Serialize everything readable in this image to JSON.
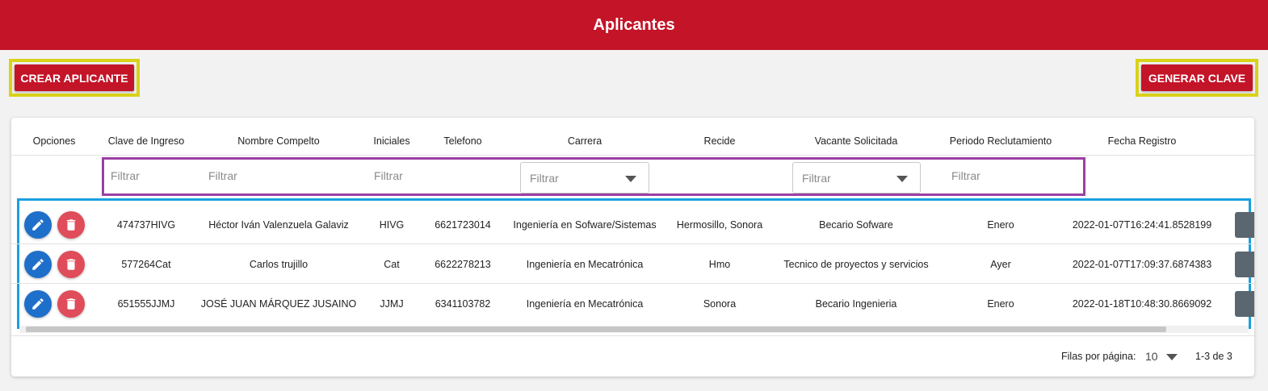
{
  "header": {
    "title": "Aplicantes"
  },
  "toolbar": {
    "create_label": "CREAR APLICANTE",
    "generate_label": "GENERAR CLAVE"
  },
  "table": {
    "columns": [
      "Opciones",
      "Clave de Ingreso",
      "Nombre Compelto",
      "Iniciales",
      "Telefono",
      "Carrera",
      "Recide",
      "Vacante Solicitada",
      "Periodo Reclutamiento",
      "Fecha Registro"
    ],
    "filter_placeholder": "Filtrar",
    "rows": [
      {
        "clave": "474737HIVG",
        "nombre": "Héctor Iván Valenzuela Galaviz",
        "iniciales": "HIVG",
        "telefono": "6621723014",
        "carrera": "Ingeniería en Sofware/Sistemas",
        "recide": "Hermosillo, Sonora",
        "vacante": "Becario Sofware",
        "periodo": "Enero",
        "fecha": "2022-01-07T16:24:41.8528199"
      },
      {
        "clave": "577264Cat",
        "nombre": "Carlos trujillo",
        "iniciales": "Cat",
        "telefono": "6622278213",
        "carrera": "Ingeniería en Mecatrónica",
        "recide": "Hmo",
        "vacante": "Tecnico de proyectos y servicios",
        "periodo": "Ayer",
        "fecha": "2022-01-07T17:09:37.6874383"
      },
      {
        "clave": "651555JJMJ",
        "nombre": "JOSÉ JUAN MÁRQUEZ JUSAINO",
        "iniciales": "JJMJ",
        "telefono": "6341103782",
        "carrera": "Ingeniería en Mecatrónica",
        "recide": "Sonora",
        "vacante": "Becario Ingenieria",
        "periodo": "Enero",
        "fecha": "2022-01-18T10:48:30.8669092"
      }
    ]
  },
  "pagination": {
    "rows_per_page_label": "Filas por página:",
    "rows_per_page": "10",
    "range": "1-3 de 3"
  },
  "icons": {
    "edit": "pencil-icon",
    "delete": "trash-icon",
    "dropdown": "chevron-down-icon"
  },
  "colors": {
    "brand": "#c41428",
    "highlight_buttons": "#d9d219",
    "highlight_filters": "#9b3fa4",
    "highlight_rows": "#1aa0e0",
    "edit_button": "#1e6fc9",
    "delete_button": "#e04c5a"
  }
}
